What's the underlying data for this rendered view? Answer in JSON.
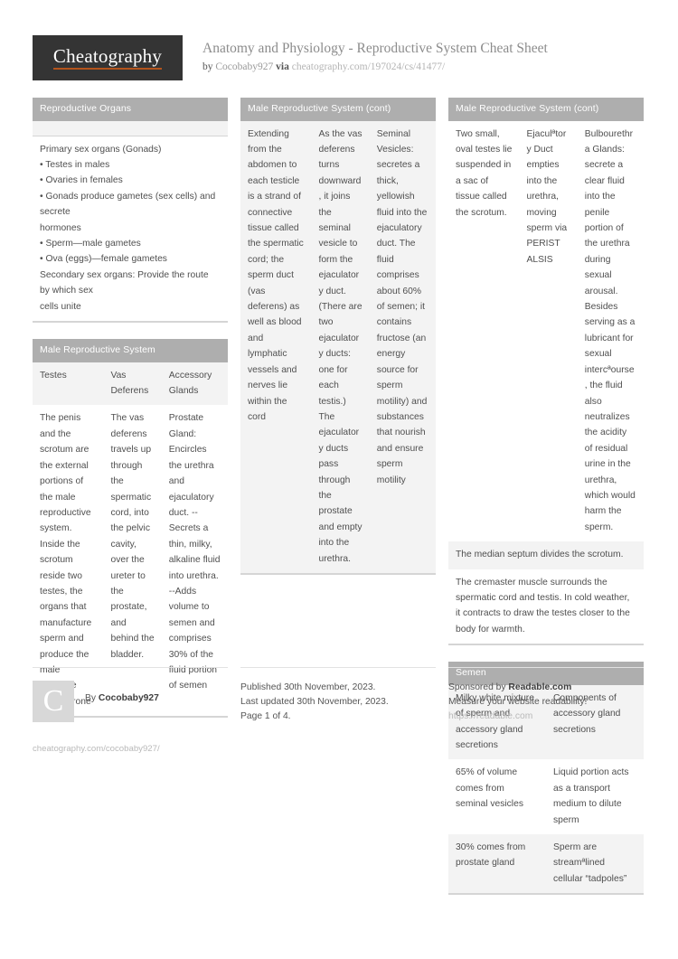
{
  "masthead": {
    "logo_text": "Cheatography",
    "title": "Anatomy and Physiology - Reproductive System Cheat Sheet",
    "by_label": "by",
    "author": "Cocobaby927",
    "via_label": "via",
    "source_url": "cheatography.com/197024/cs/41477/"
  },
  "blocks": {
    "reproductive_organs": {
      "title": "Reproductive Organs",
      "rows": [
        [
          "Primary sex organs (Gonads)\n• Testes in males\n• Ovaries in females\n•  Gonads produce gametes (sex cells) and secrete\nhormones\n• Sperm—male gametes\n• Ova (eggs)—female gametes\nSecondary sex organs: Provide the route by which sex\ncells unite"
        ]
      ]
    },
    "male_reproductive_system": {
      "title": "Male Reproductive System",
      "header": [
        "Testes",
        "Vas Deferens",
        "Accessory Glands"
      ],
      "rows": [
        [
          "The penis and the scrotum are the external portions of the male reprod­uctive system. Inside the scrotum reside two testes, the organs that manufacture sperm and produce the male hormone testosterone",
          "The vas deferens travels up through the spermatic cord, into the pelvic cavity, over the ureter to the prostate, and behind the bladder.",
          "Prostate Gland: Encircles the urethra and ejaculatory duct. -- Secrets a thin, milky, alkaline fluid into urethra. --Adds volume to semen and comprises 30% of the fluid portion of semen"
        ]
      ]
    },
    "male_reproductive_system_cont_2": {
      "title": "Male Reproductive System (cont)",
      "rows": [
        [
          "Extending from the abdomen to each testicle is a strand of connective tissue called the spermatic cord; the sperm duct (vas deferens) as well as blood and lymphatic vessels and nerves lie within the cord",
          "As the vas deferens turns downward, it joins the seminal vesicle to form the ejaculatory duct. (There are two ejaculatory ducts: one for each testis.) The ejaculatory ducts pass through the prostate and empty into the urethra.",
          "Seminal Vesicles: secretes a thick, yellowish fluid into the ejaculatory duct. The fluid comprises about 60% of semen; it contains fructose (an energy source for sperm motility) and substances that nourish and ensure sperm motility"
        ]
      ]
    },
    "male_reproductive_system_cont_3": {
      "title": "Male Reproductive System (cont)",
      "rows": [
        [
          "Two small, oval testes lie suspended in a sac of tissue called the scrotum.",
          "Ejaculªtory Duct empties into the urethra, moving sperm via PERIST ALSIS",
          "Bulbourethra Glands: secrete a clear fluid into the penile portion of the urethra during sexual arousal. Besides serving as a lubricant for sexual intercªourse, the fluid also neutralizes the acidity of residual urine in the urethra, which would harm the sperm."
        ]
      ],
      "full_rows": [
        "The median septum divides the scrotum.",
        "The cremaster muscle surrounds the spermatic cord and testis. In cold weather, it contracts to draw the testes closer to the body for warmth."
      ]
    },
    "semen": {
      "title": "Semen",
      "rows": [
        [
          "Milky white mixture of sperm and accessory gland secretions",
          "Components of accessory gland secretions"
        ],
        [
          "65% of volume comes from seminal vesicles",
          "Liquid portion acts as a transport medium to dilute sperm"
        ],
        [
          "30% comes from prostate gland",
          "Sperm are streamªlined cellular “tadpoles”"
        ]
      ]
    }
  },
  "footer": {
    "avatar_letter": "C",
    "by_label": "By ",
    "author": "Cocobaby927",
    "author_url": "cheatography.com/cocobaby927/",
    "published": "Published 30th November, 2023.",
    "updated": "Last updated 30th November, 2023.",
    "page": "Page 1 of 4.",
    "sponsor_prefix": "Sponsored by ",
    "sponsor_name": "Readable.com",
    "sponsor_tagline": "Measure your website readability!",
    "sponsor_url": "https://readable.com"
  },
  "colors": {
    "block_header_bg": "#aeaeae",
    "logo_bg": "#343434",
    "logo_underline": "#b4541c",
    "row_alt_bg": "#f3f3f3",
    "text": "#4f4f4f"
  }
}
